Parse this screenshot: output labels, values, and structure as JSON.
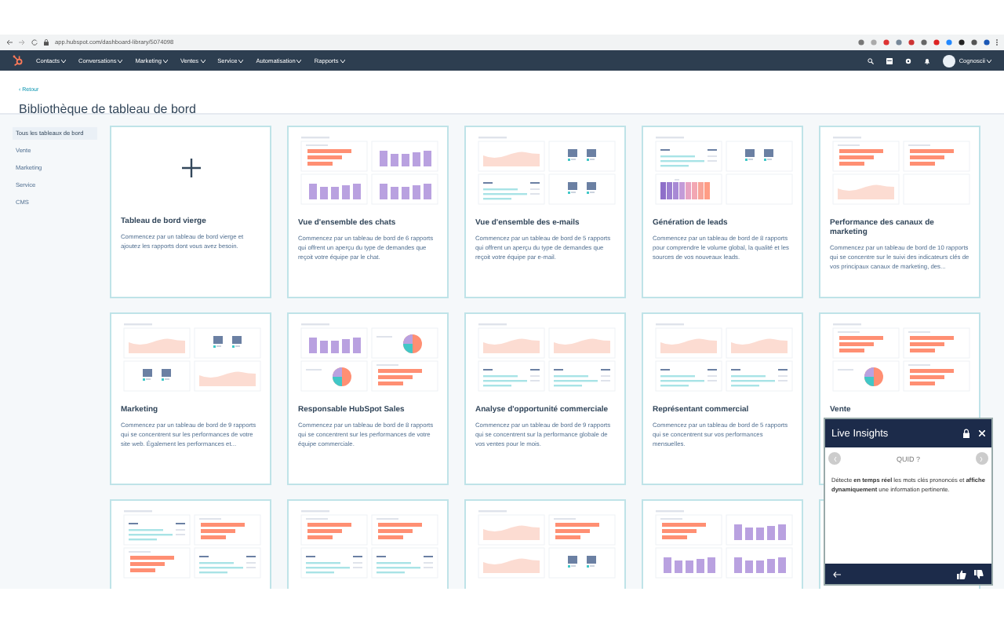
{
  "browser": {
    "url": "app.hubspot.com/dashboard-library/5074098"
  },
  "nav": {
    "items": [
      {
        "label": "Contacts"
      },
      {
        "label": "Conversations"
      },
      {
        "label": "Marketing"
      },
      {
        "label": "Ventes"
      },
      {
        "label": "Service"
      },
      {
        "label": "Automatisation"
      },
      {
        "label": "Rapports"
      }
    ],
    "user": "Cognoscii"
  },
  "back_link": "‹ Retour",
  "title": "Bibliothèque de tableau de bord",
  "sidebar": {
    "items": [
      {
        "label": "Tous les tableaux de bord",
        "selected": true
      },
      {
        "label": "Vente",
        "selected": false
      },
      {
        "label": "Marketing",
        "selected": false
      },
      {
        "label": "Service",
        "selected": false
      },
      {
        "label": "CMS",
        "selected": false
      }
    ]
  },
  "cards": [
    {
      "kind": "blank",
      "title": "Tableau de bord vierge",
      "description": "Commencez par un tableau de bord vierge et ajoutez les rapports dont vous avez besoin."
    },
    {
      "kind": "template",
      "preview": [
        {
          "kind": "hbars"
        },
        {
          "kind": "vbars"
        },
        {
          "kind": "vbars"
        },
        {
          "kind": "vbars"
        }
      ],
      "title": "Vue d'ensemble des chats",
      "description": "Commencez par un tableau de bord de 6 rapports qui offrent un aperçu du type de demandes que reçoit votre équipe par le chat."
    },
    {
      "kind": "template",
      "preview": [
        {
          "kind": "area"
        },
        {
          "kind": "kpis"
        },
        {
          "kind": "table"
        },
        {
          "kind": "kpis"
        }
      ],
      "title": "Vue d'ensemble des e-mails",
      "description": "Commencez par un tableau de bord de 5 rapports qui offrent un aperçu du type de demandes que reçoit votre équipe par e-mail."
    },
    {
      "kind": "template",
      "preview": [
        {
          "kind": "table"
        },
        {
          "kind": "kpis"
        },
        {
          "kind": "strip"
        },
        {
          "kind": "empty"
        }
      ],
      "title": "Génération de leads",
      "description": "Commencez par un tableau de bord de 8 rapports pour comprendre le volume global, la qualité et les sources de vos nouveaux leads."
    },
    {
      "kind": "template",
      "preview": [
        {
          "kind": "hbars"
        },
        {
          "kind": "hbars"
        },
        {
          "kind": "area"
        },
        {
          "kind": "empty"
        }
      ],
      "title": "Performance des canaux de marketing",
      "description": "Commencez par un tableau de bord de 10 rapports qui se concentre sur le suivi des indicateurs clés de vos principaux canaux de marketing, des..."
    },
    {
      "kind": "template",
      "preview": [
        {
          "kind": "area"
        },
        {
          "kind": "kpis"
        },
        {
          "kind": "kpis"
        },
        {
          "kind": "area"
        }
      ],
      "title": "Marketing",
      "description": "Commencez par un tableau de bord de 9 rapports qui se concentrent sur les performances de votre site web. Également les performances et..."
    },
    {
      "kind": "template",
      "preview": [
        {
          "kind": "vbars"
        },
        {
          "kind": "pie"
        },
        {
          "kind": "pie"
        },
        {
          "kind": "hbars"
        }
      ],
      "title": "Responsable HubSpot Sales",
      "description": "Commencez par un tableau de bord de 8 rapports qui se concentrent sur les performances de votre équipe commerciale."
    },
    {
      "kind": "template",
      "preview": [
        {
          "kind": "area"
        },
        {
          "kind": "area"
        },
        {
          "kind": "table"
        },
        {
          "kind": "table"
        }
      ],
      "title": "Analyse d'opportunité commerciale",
      "description": "Commencez par un tableau de bord de 9 rapports qui se concentrent sur la performance globale de vos ventes pour le mois."
    },
    {
      "kind": "template",
      "preview": [
        {
          "kind": "area"
        },
        {
          "kind": "area"
        },
        {
          "kind": "table"
        },
        {
          "kind": "table"
        }
      ],
      "title": "Représentant commercial",
      "description": "Commencez par un tableau de bord de 5 rapports qui se concentrent sur vos performances mensuelles."
    },
    {
      "kind": "template",
      "preview": [
        {
          "kind": "hbars"
        },
        {
          "kind": "hbars"
        },
        {
          "kind": "pie"
        },
        {
          "kind": "hbars"
        }
      ],
      "title": "Vente"
    },
    {
      "kind": "template",
      "preview": [
        {
          "kind": "table"
        },
        {
          "kind": "hbars"
        },
        {
          "kind": "hbars"
        },
        {
          "kind": "table"
        }
      ]
    },
    {
      "kind": "template",
      "preview": [
        {
          "kind": "hbars"
        },
        {
          "kind": "hbars"
        },
        {
          "kind": "table"
        },
        {
          "kind": "table"
        }
      ]
    },
    {
      "kind": "template",
      "preview": [
        {
          "kind": "area"
        },
        {
          "kind": "hbars"
        },
        {
          "kind": "area"
        },
        {
          "kind": "kpis"
        }
      ]
    },
    {
      "kind": "template",
      "preview": [
        {
          "kind": "hbars"
        },
        {
          "kind": "vbars"
        },
        {
          "kind": "vbars"
        },
        {
          "kind": "vbars"
        }
      ]
    },
    {
      "kind": "template"
    }
  ],
  "insights": {
    "title": "Live Insights",
    "heading": "QUID ?",
    "text": "Détecte **en temps réel** les mots clés prononcés et **affiche dynamiquement** une information pertinente."
  }
}
